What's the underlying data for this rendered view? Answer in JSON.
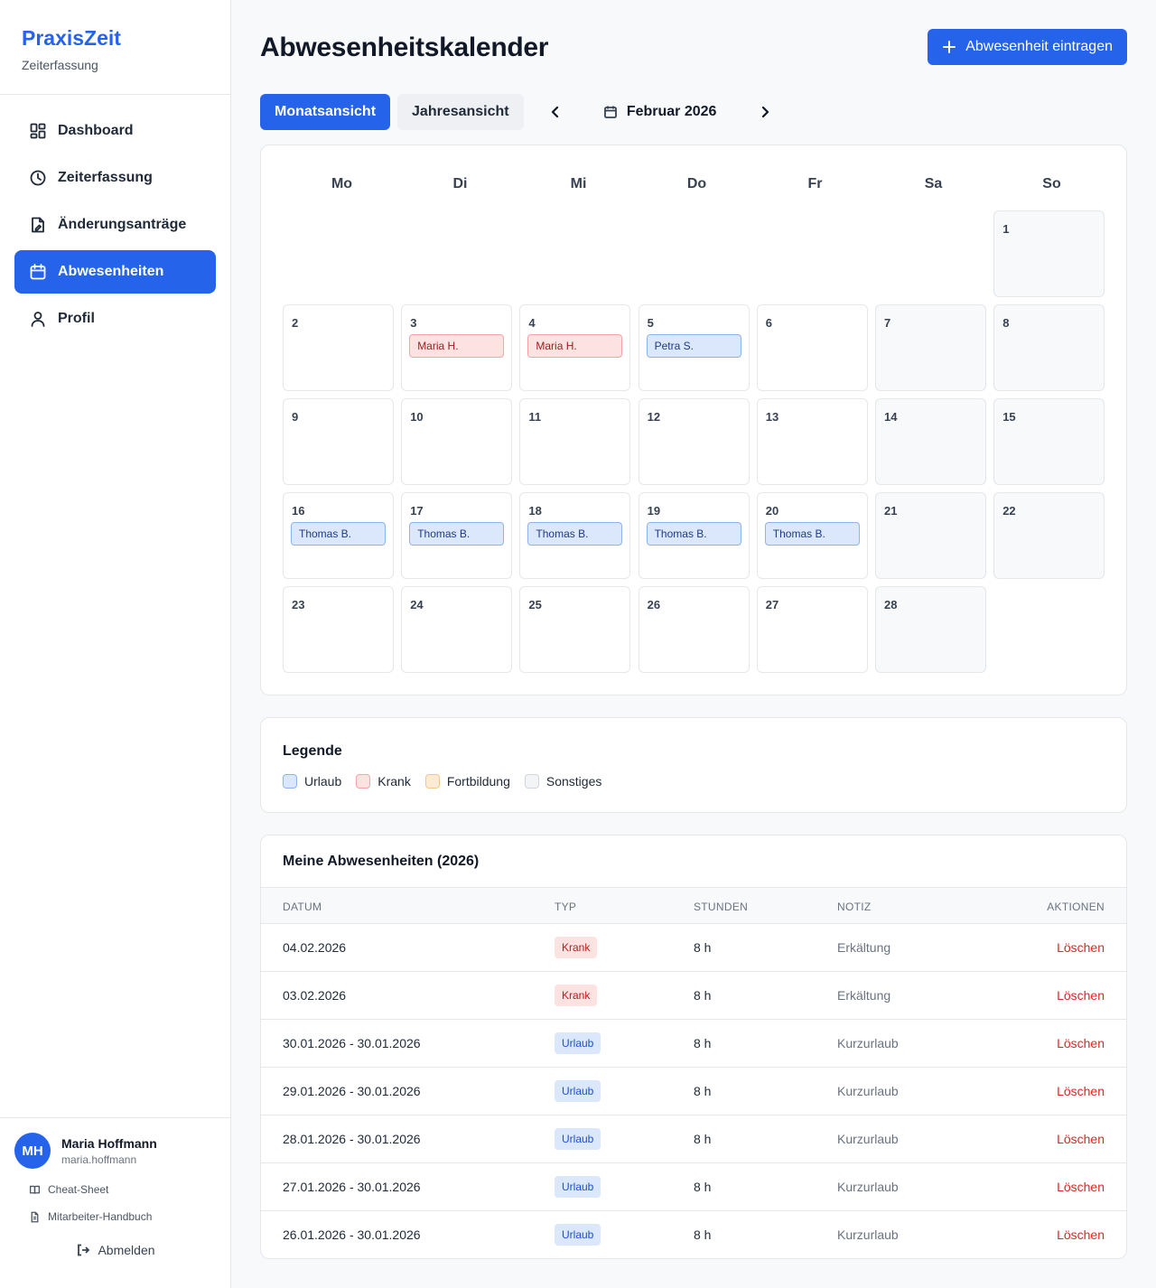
{
  "brand": {
    "title": "PraxisZeit",
    "subtitle": "Zeiterfassung"
  },
  "nav": [
    {
      "label": "Dashboard",
      "icon": "dashboard-icon",
      "active": false
    },
    {
      "label": "Zeiterfassung",
      "icon": "clock-icon",
      "active": false
    },
    {
      "label": "Änderungsanträge",
      "icon": "document-edit-icon",
      "active": false
    },
    {
      "label": "Abwesenheiten",
      "icon": "calendar-icon",
      "active": true
    },
    {
      "label": "Profil",
      "icon": "user-icon",
      "active": false
    }
  ],
  "user": {
    "initials": "MH",
    "name": "Maria Hoffmann",
    "username": "maria.hoffmann",
    "links": {
      "cheatsheet": "Cheat-Sheet",
      "handbook": "Mitarbeiter-Handbuch"
    },
    "logout": "Abmelden"
  },
  "page": {
    "title": "Abwesenheitskalender",
    "add_button": "Abwesenheit eintragen"
  },
  "view": {
    "month_tab": "Monatsansicht",
    "year_tab": "Jahresansicht",
    "current_month": "Februar 2026"
  },
  "calendar": {
    "weekdays": [
      "Mo",
      "Di",
      "Mi",
      "Do",
      "Fr",
      "Sa",
      "So"
    ],
    "first_weekday_index": 6,
    "days": [
      {
        "n": "1"
      },
      {
        "n": "2"
      },
      {
        "n": "3",
        "event": "Maria H.",
        "type": "krank"
      },
      {
        "n": "4",
        "event": "Maria H.",
        "type": "krank"
      },
      {
        "n": "5",
        "event": "Petra S.",
        "type": "urlaub"
      },
      {
        "n": "6"
      },
      {
        "n": "7"
      },
      {
        "n": "8"
      },
      {
        "n": "9"
      },
      {
        "n": "10"
      },
      {
        "n": "11"
      },
      {
        "n": "12"
      },
      {
        "n": "13"
      },
      {
        "n": "14"
      },
      {
        "n": "15"
      },
      {
        "n": "16",
        "event": "Thomas B.",
        "type": "urlaub"
      },
      {
        "n": "17",
        "event": "Thomas B.",
        "type": "urlaub"
      },
      {
        "n": "18",
        "event": "Thomas B.",
        "type": "urlaub"
      },
      {
        "n": "19",
        "event": "Thomas B.",
        "type": "urlaub"
      },
      {
        "n": "20",
        "event": "Thomas B.",
        "type": "urlaub"
      },
      {
        "n": "21"
      },
      {
        "n": "22"
      },
      {
        "n": "23"
      },
      {
        "n": "24"
      },
      {
        "n": "25"
      },
      {
        "n": "26"
      },
      {
        "n": "27"
      },
      {
        "n": "28"
      }
    ]
  },
  "legend": {
    "title": "Legende",
    "items": [
      {
        "label": "Urlaub",
        "color": "#dbe8fb",
        "border": "#8fb3ec"
      },
      {
        "label": "Krank",
        "color": "#fde2e2",
        "border": "#f5a3a3"
      },
      {
        "label": "Fortbildung",
        "color": "#fdebd3",
        "border": "#f5c58f"
      },
      {
        "label": "Sonstiges",
        "color": "#f3f4f6",
        "border": "#d1d5db"
      }
    ]
  },
  "absences": {
    "title": "Meine Abwesenheiten (2026)",
    "columns": {
      "date": "DATUM",
      "type": "TYP",
      "hours": "STUNDEN",
      "note": "NOTIZ",
      "actions": "AKTIONEN"
    },
    "delete_label": "Löschen",
    "rows": [
      {
        "date": "04.02.2026",
        "type": "Krank",
        "kind": "krank",
        "hours": "8 h",
        "note": "Erkältung"
      },
      {
        "date": "03.02.2026",
        "type": "Krank",
        "kind": "krank",
        "hours": "8 h",
        "note": "Erkältung"
      },
      {
        "date": "30.01.2026 - 30.01.2026",
        "type": "Urlaub",
        "kind": "urlaub",
        "hours": "8 h",
        "note": "Kurzurlaub"
      },
      {
        "date": "29.01.2026 - 30.01.2026",
        "type": "Urlaub",
        "kind": "urlaub",
        "hours": "8 h",
        "note": "Kurzurlaub"
      },
      {
        "date": "28.01.2026 - 30.01.2026",
        "type": "Urlaub",
        "kind": "urlaub",
        "hours": "8 h",
        "note": "Kurzurlaub"
      },
      {
        "date": "27.01.2026 - 30.01.2026",
        "type": "Urlaub",
        "kind": "urlaub",
        "hours": "8 h",
        "note": "Kurzurlaub"
      },
      {
        "date": "26.01.2026 - 30.01.2026",
        "type": "Urlaub",
        "kind": "urlaub",
        "hours": "8 h",
        "note": "Kurzurlaub"
      }
    ]
  }
}
